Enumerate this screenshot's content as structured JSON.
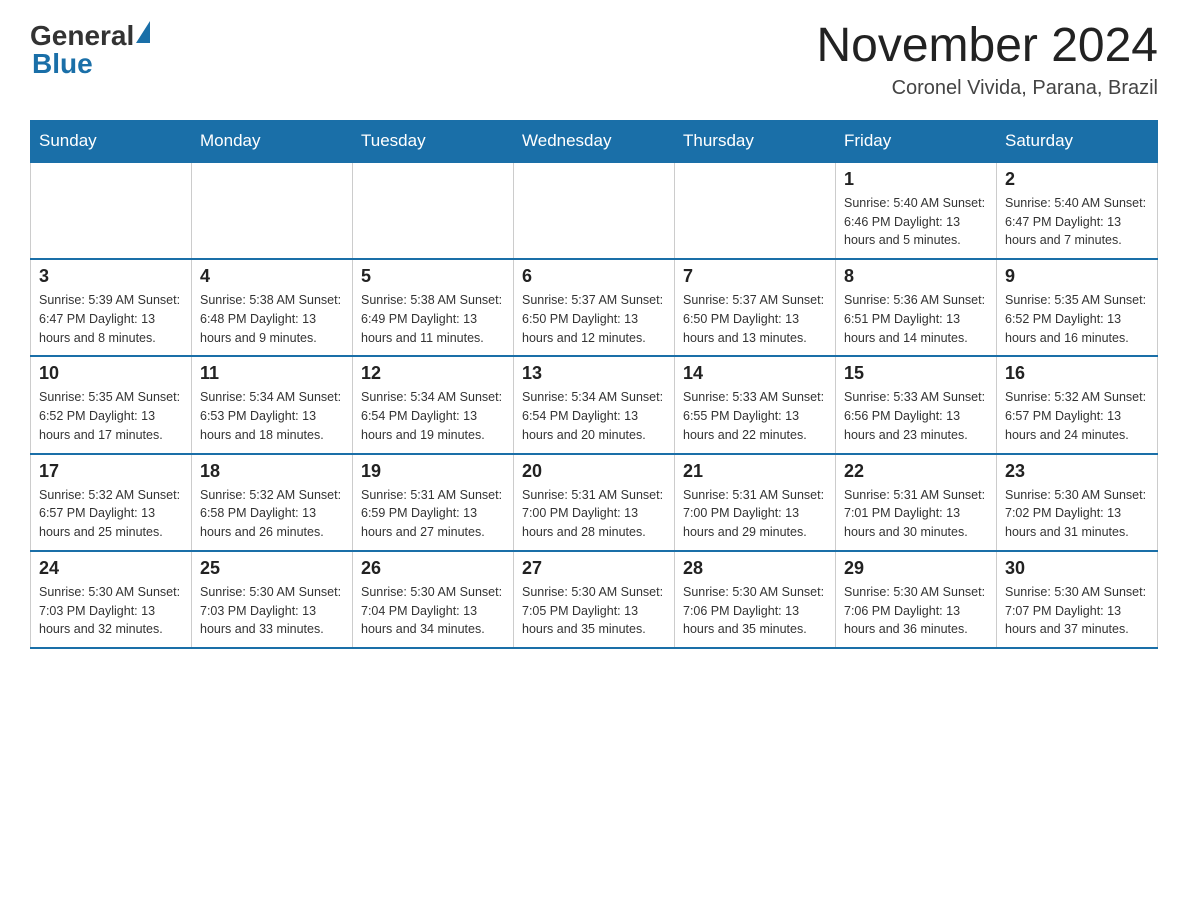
{
  "header": {
    "logo_general": "General",
    "logo_blue": "Blue",
    "title": "November 2024",
    "subtitle": "Coronel Vivida, Parana, Brazil"
  },
  "calendar": {
    "days_of_week": [
      "Sunday",
      "Monday",
      "Tuesday",
      "Wednesday",
      "Thursday",
      "Friday",
      "Saturday"
    ],
    "weeks": [
      [
        {
          "day": "",
          "info": ""
        },
        {
          "day": "",
          "info": ""
        },
        {
          "day": "",
          "info": ""
        },
        {
          "day": "",
          "info": ""
        },
        {
          "day": "",
          "info": ""
        },
        {
          "day": "1",
          "info": "Sunrise: 5:40 AM\nSunset: 6:46 PM\nDaylight: 13 hours and 5 minutes."
        },
        {
          "day": "2",
          "info": "Sunrise: 5:40 AM\nSunset: 6:47 PM\nDaylight: 13 hours and 7 minutes."
        }
      ],
      [
        {
          "day": "3",
          "info": "Sunrise: 5:39 AM\nSunset: 6:47 PM\nDaylight: 13 hours and 8 minutes."
        },
        {
          "day": "4",
          "info": "Sunrise: 5:38 AM\nSunset: 6:48 PM\nDaylight: 13 hours and 9 minutes."
        },
        {
          "day": "5",
          "info": "Sunrise: 5:38 AM\nSunset: 6:49 PM\nDaylight: 13 hours and 11 minutes."
        },
        {
          "day": "6",
          "info": "Sunrise: 5:37 AM\nSunset: 6:50 PM\nDaylight: 13 hours and 12 minutes."
        },
        {
          "day": "7",
          "info": "Sunrise: 5:37 AM\nSunset: 6:50 PM\nDaylight: 13 hours and 13 minutes."
        },
        {
          "day": "8",
          "info": "Sunrise: 5:36 AM\nSunset: 6:51 PM\nDaylight: 13 hours and 14 minutes."
        },
        {
          "day": "9",
          "info": "Sunrise: 5:35 AM\nSunset: 6:52 PM\nDaylight: 13 hours and 16 minutes."
        }
      ],
      [
        {
          "day": "10",
          "info": "Sunrise: 5:35 AM\nSunset: 6:52 PM\nDaylight: 13 hours and 17 minutes."
        },
        {
          "day": "11",
          "info": "Sunrise: 5:34 AM\nSunset: 6:53 PM\nDaylight: 13 hours and 18 minutes."
        },
        {
          "day": "12",
          "info": "Sunrise: 5:34 AM\nSunset: 6:54 PM\nDaylight: 13 hours and 19 minutes."
        },
        {
          "day": "13",
          "info": "Sunrise: 5:34 AM\nSunset: 6:54 PM\nDaylight: 13 hours and 20 minutes."
        },
        {
          "day": "14",
          "info": "Sunrise: 5:33 AM\nSunset: 6:55 PM\nDaylight: 13 hours and 22 minutes."
        },
        {
          "day": "15",
          "info": "Sunrise: 5:33 AM\nSunset: 6:56 PM\nDaylight: 13 hours and 23 minutes."
        },
        {
          "day": "16",
          "info": "Sunrise: 5:32 AM\nSunset: 6:57 PM\nDaylight: 13 hours and 24 minutes."
        }
      ],
      [
        {
          "day": "17",
          "info": "Sunrise: 5:32 AM\nSunset: 6:57 PM\nDaylight: 13 hours and 25 minutes."
        },
        {
          "day": "18",
          "info": "Sunrise: 5:32 AM\nSunset: 6:58 PM\nDaylight: 13 hours and 26 minutes."
        },
        {
          "day": "19",
          "info": "Sunrise: 5:31 AM\nSunset: 6:59 PM\nDaylight: 13 hours and 27 minutes."
        },
        {
          "day": "20",
          "info": "Sunrise: 5:31 AM\nSunset: 7:00 PM\nDaylight: 13 hours and 28 minutes."
        },
        {
          "day": "21",
          "info": "Sunrise: 5:31 AM\nSunset: 7:00 PM\nDaylight: 13 hours and 29 minutes."
        },
        {
          "day": "22",
          "info": "Sunrise: 5:31 AM\nSunset: 7:01 PM\nDaylight: 13 hours and 30 minutes."
        },
        {
          "day": "23",
          "info": "Sunrise: 5:30 AM\nSunset: 7:02 PM\nDaylight: 13 hours and 31 minutes."
        }
      ],
      [
        {
          "day": "24",
          "info": "Sunrise: 5:30 AM\nSunset: 7:03 PM\nDaylight: 13 hours and 32 minutes."
        },
        {
          "day": "25",
          "info": "Sunrise: 5:30 AM\nSunset: 7:03 PM\nDaylight: 13 hours and 33 minutes."
        },
        {
          "day": "26",
          "info": "Sunrise: 5:30 AM\nSunset: 7:04 PM\nDaylight: 13 hours and 34 minutes."
        },
        {
          "day": "27",
          "info": "Sunrise: 5:30 AM\nSunset: 7:05 PM\nDaylight: 13 hours and 35 minutes."
        },
        {
          "day": "28",
          "info": "Sunrise: 5:30 AM\nSunset: 7:06 PM\nDaylight: 13 hours and 35 minutes."
        },
        {
          "day": "29",
          "info": "Sunrise: 5:30 AM\nSunset: 7:06 PM\nDaylight: 13 hours and 36 minutes."
        },
        {
          "day": "30",
          "info": "Sunrise: 5:30 AM\nSunset: 7:07 PM\nDaylight: 13 hours and 37 minutes."
        }
      ]
    ]
  }
}
